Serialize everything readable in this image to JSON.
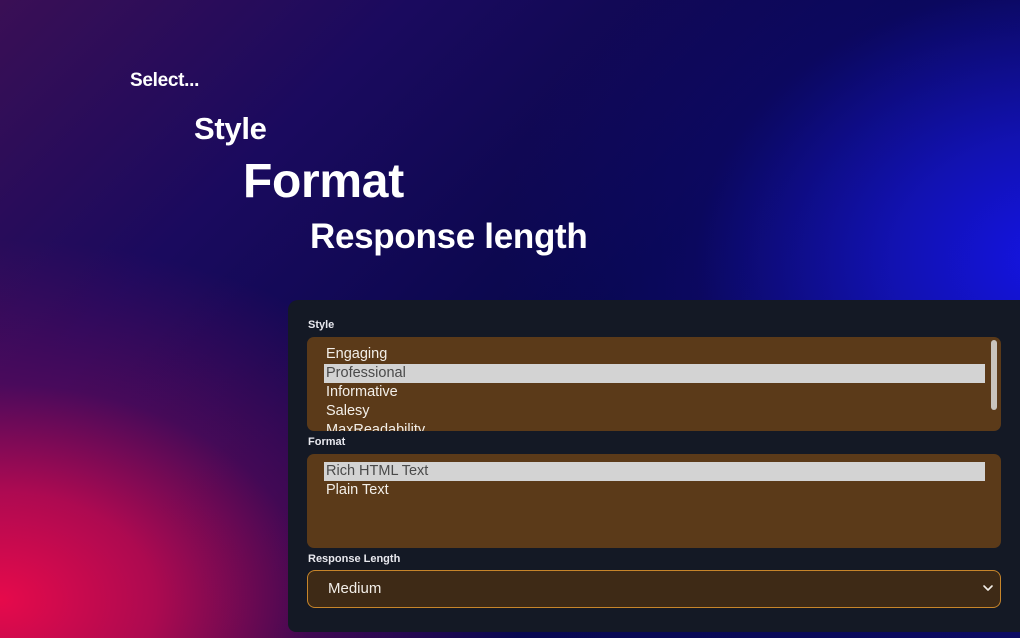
{
  "hero": {
    "select": "Select...",
    "style": "Style",
    "format": "Format",
    "response_length": "Response length"
  },
  "panel": {
    "style_label": "Style",
    "style_options": [
      "Engaging",
      "Professional",
      "Informative",
      "Salesy",
      "MaxReadability"
    ],
    "style_selected": "Professional",
    "format_label": "Format",
    "format_options": [
      "Rich HTML Text",
      "Plain Text"
    ],
    "format_selected": "Rich HTML Text",
    "length_label": "Response Length",
    "length_value": "Medium",
    "chevron_icon": "chevron-down-icon"
  },
  "colors": {
    "panel_bg": "#141925",
    "listbox_bg": "#5b3a19",
    "select_bg": "#3e2a16",
    "select_border": "#c7852a",
    "selected_option_bg": "#d3d3d3"
  }
}
